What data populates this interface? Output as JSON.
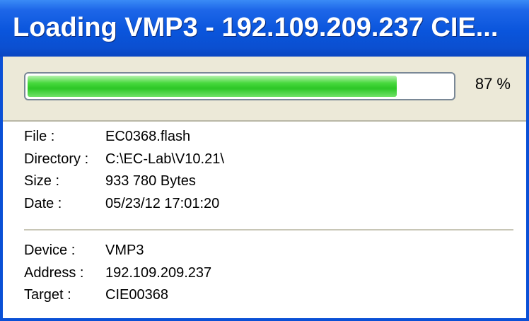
{
  "window": {
    "title": "Loading VMP3 - 192.109.209.237 CIE..."
  },
  "progress": {
    "percent": 87,
    "percent_label": "87 %"
  },
  "file_info": [
    {
      "label": "File :",
      "value": "EC0368.flash"
    },
    {
      "label": "Directory :",
      "value": "C:\\EC-Lab\\V10.21\\"
    },
    {
      "label": "Size :",
      "value": "933 780 Bytes"
    },
    {
      "label": "Date :",
      "value": "05/23/12 17:01:20"
    }
  ],
  "device_info": [
    {
      "label": "Device :",
      "value": "VMP3"
    },
    {
      "label": "Address :",
      "value": "192.109.209.237"
    },
    {
      "label": "Target :",
      "value": "CIE00368"
    }
  ],
  "colors": {
    "titlebar": "#0a55dc",
    "progress_fill": "#2cc726",
    "panel_bg": "#ece9d8"
  }
}
